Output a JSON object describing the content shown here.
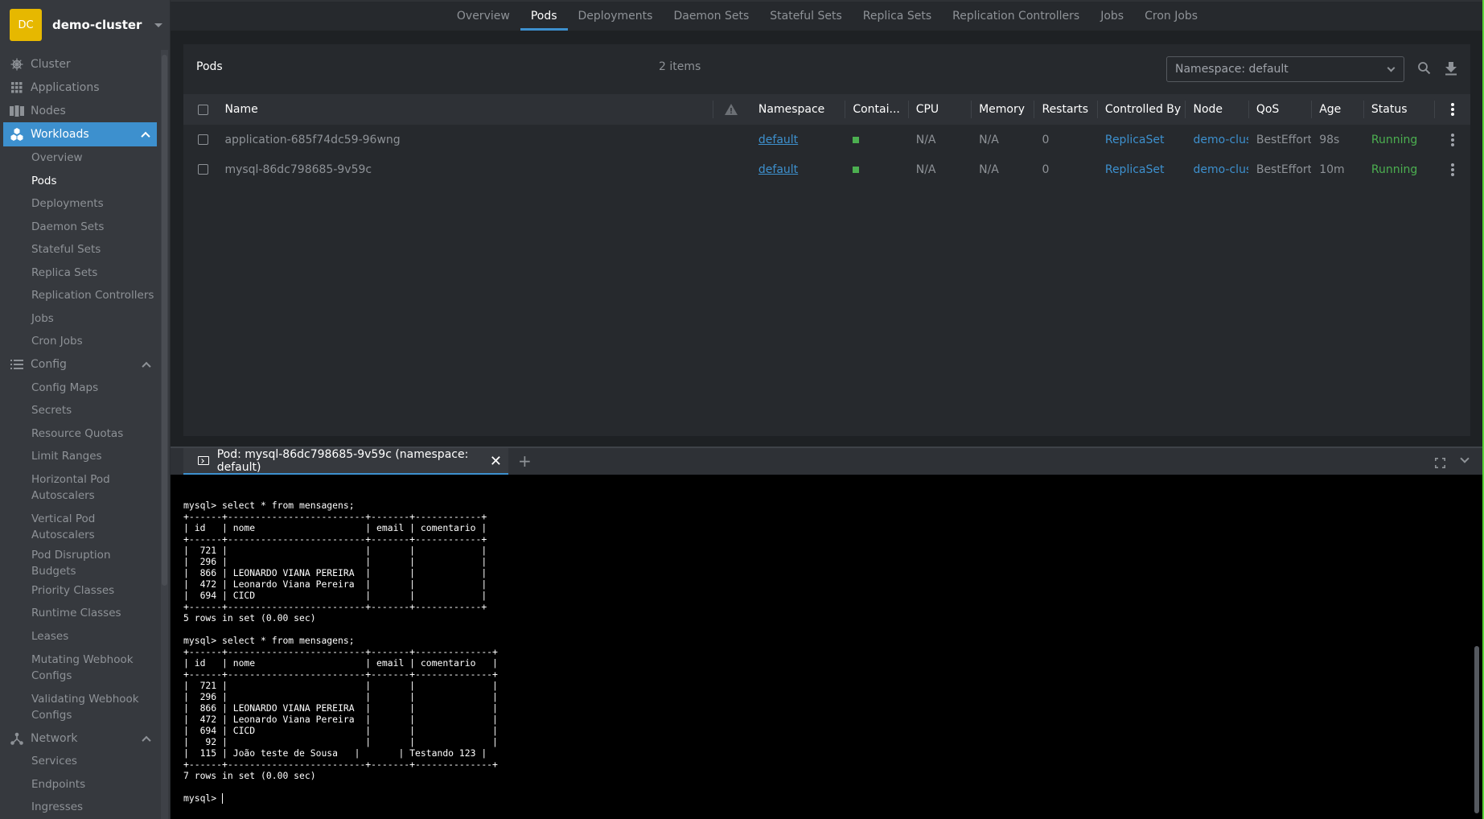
{
  "cluster": {
    "avatar_text": "DC",
    "name": "demo-cluster"
  },
  "sidebar": {
    "top_items": [
      {
        "label": "Cluster",
        "icon": "helm-wheel-icon"
      },
      {
        "label": "Applications",
        "icon": "grid-icon"
      },
      {
        "label": "Nodes",
        "icon": "server-rack-icon"
      }
    ],
    "workloads": {
      "label": "Workloads",
      "icon": "cubes-icon",
      "items": [
        "Overview",
        "Pods",
        "Deployments",
        "Daemon Sets",
        "Stateful Sets",
        "Replica Sets",
        "Replication Controllers",
        "Jobs",
        "Cron Jobs"
      ],
      "selected": "Pods"
    },
    "config": {
      "label": "Config",
      "icon": "list-icon",
      "items": [
        "Config Maps",
        "Secrets",
        "Resource Quotas",
        "Limit Ranges",
        "Horizontal Pod Autoscalers",
        "Vertical Pod Autoscalers",
        "Pod Disruption Budgets",
        "Priority Classes",
        "Runtime Classes",
        "Leases",
        "Mutating Webhook Configs",
        "Validating Webhook Configs"
      ]
    },
    "network": {
      "label": "Network",
      "icon": "network-icon",
      "items": [
        "Services",
        "Endpoints",
        "Ingresses"
      ]
    }
  },
  "top_tabs": {
    "items": [
      "Overview",
      "Pods",
      "Deployments",
      "Daemon Sets",
      "Stateful Sets",
      "Replica Sets",
      "Replication Controllers",
      "Jobs",
      "Cron Jobs"
    ],
    "active": "Pods"
  },
  "pods_panel": {
    "title": "Pods",
    "count": "2 items",
    "namespace_select": "Namespace: default",
    "columns": [
      "Name",
      "",
      "Namespace",
      "Contai...",
      "CPU",
      "Memory",
      "Restarts",
      "Controlled By",
      "Node",
      "QoS",
      "Age",
      "Status"
    ],
    "rows": [
      {
        "name": "application-685f74dc59-96wng",
        "namespace": "default",
        "containers": "running",
        "cpu": "N/A",
        "memory": "N/A",
        "restarts": "0",
        "controlled_by": "ReplicaSet",
        "node": "demo-clus",
        "qos": "BestEffort",
        "age": "98s",
        "status": "Running"
      },
      {
        "name": "mysql-86dc798685-9v59c",
        "namespace": "default",
        "containers": "running",
        "cpu": "N/A",
        "memory": "N/A",
        "restarts": "0",
        "controlled_by": "ReplicaSet",
        "node": "demo-clus",
        "qos": "BestEffort",
        "age": "10m",
        "status": "Running"
      }
    ]
  },
  "dock": {
    "tab_label": "Pod: mysql-86dc798685-9v59c (namespace: default)",
    "add_label": "+",
    "close_label": "✕",
    "terminal_lines": [
      "",
      "mysql> select * from mensagens;",
      "+------+-------------------------+-------+------------+",
      "| id   | nome                    | email | comentario |",
      "+------+-------------------------+-------+------------+",
      "|  721 |                         |       |            |",
      "|  296 |                         |       |            |",
      "|  866 | LEONARDO VIANA PEREIRA  |       |            |",
      "|  472 | Leonardo Viana Pereira  |       |            |",
      "|  694 | CICD                    |       |            |",
      "+------+-------------------------+-------+------------+",
      "5 rows in set (0.00 sec)",
      "",
      "mysql> select * from mensagens;",
      "+------+-------------------------+-------+--------------+",
      "| id   | nome                    | email | comentario   |",
      "+------+-------------------------+-------+--------------+",
      "|  721 |                         |       |              |",
      "|  296 |                         |       |              |",
      "|  866 | LEONARDO VIANA PEREIRA  |       |              |",
      "|  472 | Leonardo Viana Pereira  |       |              |",
      "|  694 | CICD                    |       |              |",
      "|   92 |                         |       |              |",
      "|  115 | João teste de Sousa   |       | Testando 123 |",
      "+------+-------------------------+-------+--------------+",
      "7 rows in set (0.00 sec)",
      "",
      "mysql> "
    ]
  },
  "colors": {
    "accent": "#3d90ce",
    "running": "#4caf50",
    "cluster_avatar": "#e6b800"
  }
}
